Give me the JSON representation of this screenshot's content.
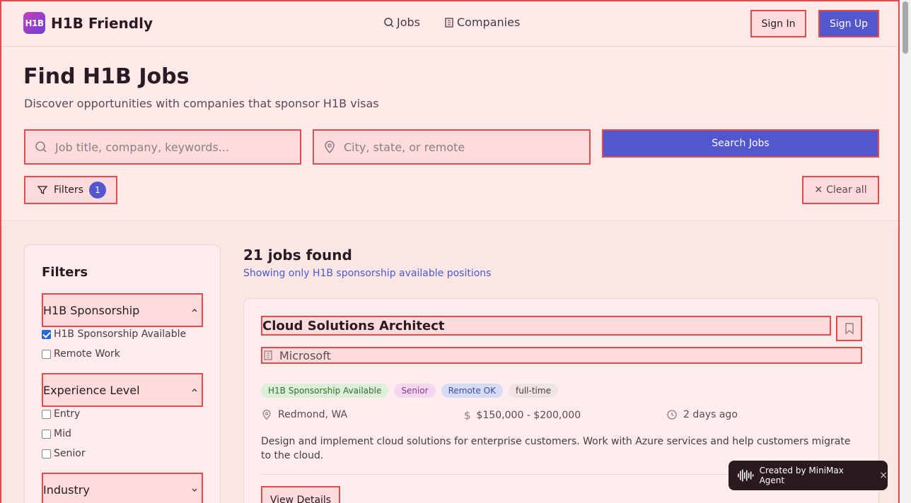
{
  "header": {
    "logo_badge": "H1B",
    "logo_text": "H1B Friendly",
    "nav": {
      "jobs": "Jobs",
      "companies": "Companies"
    },
    "sign_in": "Sign In",
    "sign_up": "Sign Up"
  },
  "hero": {
    "title": "Find H1B Jobs",
    "subtitle": "Discover opportunities with companies that sponsor H1B visas",
    "search_placeholder": "Job title, company, keywords...",
    "location_placeholder": "City, state, or remote",
    "search_button": "Search Jobs",
    "filters_button": "Filters",
    "filters_count": "1",
    "clear_all": "Clear all"
  },
  "sidebar": {
    "title": "Filters",
    "sections": [
      {
        "label": "H1B Sponsorship",
        "options": [
          {
            "label": "H1B Sponsorship Available",
            "checked": true
          },
          {
            "label": "Remote Work",
            "checked": false
          }
        ]
      },
      {
        "label": "Experience Level",
        "options": [
          {
            "label": "Entry",
            "checked": false
          },
          {
            "label": "Mid",
            "checked": false
          },
          {
            "label": "Senior",
            "checked": false
          }
        ]
      },
      {
        "label": "Industry",
        "options": []
      }
    ]
  },
  "results": {
    "count": "21 jobs found",
    "note": "Showing only H1B sponsorship available positions"
  },
  "job": {
    "title": "Cloud Solutions Architect",
    "company": "Microsoft",
    "tags": [
      "H1B Sponsorship Available",
      "Senior",
      "Remote OK",
      "full-time"
    ],
    "location": "Redmond, WA",
    "salary": "$150,000 - $200,000",
    "posted": "2 days ago",
    "description": "Design and implement cloud solutions for enterprise customers. Work with Azure services and help customers migrate to the cloud.",
    "details_button": "View Details"
  },
  "toast": {
    "text": "Created by MiniMax Agent",
    "close": "×"
  },
  "colors": {
    "accent": "#5257d0",
    "highlight_border": "#e64a4a",
    "highlight_fill": "#ffdcdc"
  }
}
